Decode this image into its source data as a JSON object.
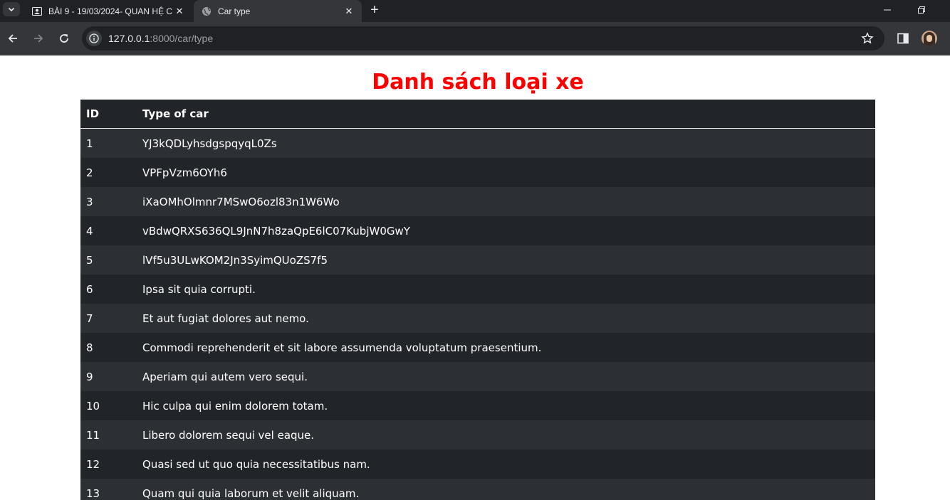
{
  "browser": {
    "tabs": [
      {
        "title": "BÀI 9 - 19/03/2024- QUAN HỆ C",
        "active": false,
        "icon": "person-card-icon"
      },
      {
        "title": "Car type",
        "active": true,
        "icon": "globe-icon"
      }
    ],
    "url_host": "127.0.0.1",
    "url_rest": ":8000/car/type"
  },
  "page": {
    "heading": "Danh sách loại xe",
    "heading_color": "#ff0000",
    "columns": {
      "id": "ID",
      "type": "Type of car"
    },
    "rows": [
      {
        "id": "1",
        "type": "YJ3kQDLyhsdgspqyqL0Zs"
      },
      {
        "id": "2",
        "type": "VPFpVzm6OYh6"
      },
      {
        "id": "3",
        "type": "iXaOMhOlmnr7MSwO6ozl83n1W6Wo"
      },
      {
        "id": "4",
        "type": "vBdwQRXS636QL9JnN7h8zaQpE6lC07KubjW0GwY"
      },
      {
        "id": "5",
        "type": "lVf5u3ULwKOM2Jn3SyimQUoZS7f5"
      },
      {
        "id": "6",
        "type": "Ipsa sit quia corrupti."
      },
      {
        "id": "7",
        "type": "Et aut fugiat dolores aut nemo."
      },
      {
        "id": "8",
        "type": "Commodi reprehenderit et sit labore assumenda voluptatum praesentium."
      },
      {
        "id": "9",
        "type": "Aperiam qui autem vero sequi."
      },
      {
        "id": "10",
        "type": "Hic culpa qui enim dolorem totam."
      },
      {
        "id": "11",
        "type": "Libero dolorem sequi vel eaque."
      },
      {
        "id": "12",
        "type": "Quasi sed ut quo quia necessitatibus nam."
      },
      {
        "id": "13",
        "type": "Quam qui quia laborum et velit aliquam."
      }
    ]
  }
}
